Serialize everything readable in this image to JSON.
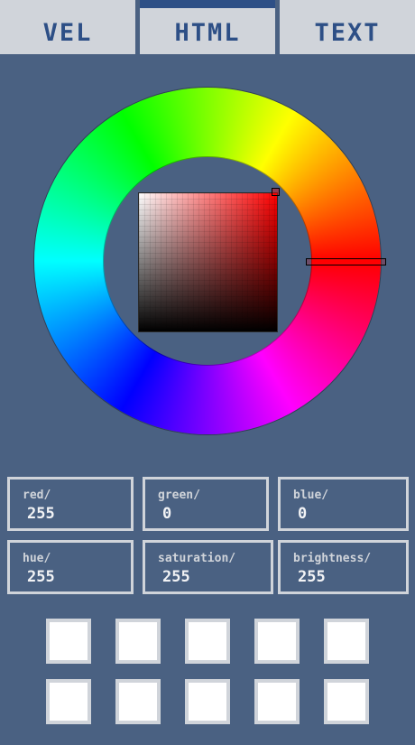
{
  "tabs": [
    {
      "label": "VEL",
      "active": false
    },
    {
      "label": "HTML",
      "active": true
    },
    {
      "label": "TEXT",
      "active": false
    }
  ],
  "colors": {
    "background": "#4a6182",
    "panel": "#d0d4da",
    "accent": "#2d4f86",
    "selected_hue": "#ff0000"
  },
  "fields": {
    "red": {
      "label": "red/",
      "value": "255"
    },
    "green": {
      "label": "green/",
      "value": "0"
    },
    "blue": {
      "label": "blue/",
      "value": "0"
    },
    "hue": {
      "label": "hue/",
      "value": "255"
    },
    "saturation": {
      "label": "saturation/",
      "value": "255"
    },
    "brightness": {
      "label": "brightness/",
      "value": "255"
    }
  },
  "swatches": [
    "#ffffff",
    "#ffffff",
    "#ffffff",
    "#ffffff",
    "#ffffff",
    "#ffffff",
    "#ffffff",
    "#ffffff",
    "#ffffff",
    "#ffffff"
  ]
}
